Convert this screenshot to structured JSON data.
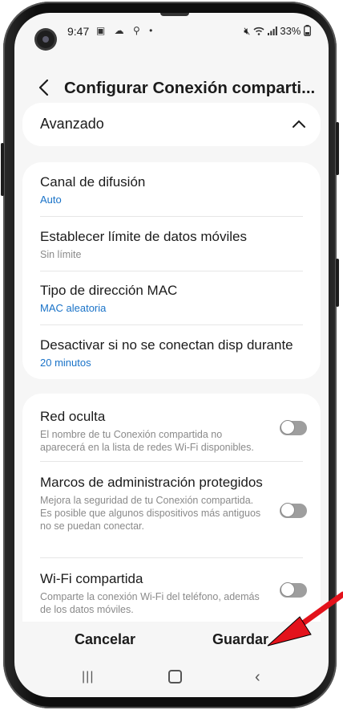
{
  "status_bar": {
    "time": "9:47",
    "left_icons": "▣ ☁ ⚲ •",
    "right_text": "33%"
  },
  "header": {
    "title": "Configurar Conexión comparti..."
  },
  "advanced": {
    "label": "Avanzado"
  },
  "settings": [
    {
      "title": "Canal de difusión",
      "value": "Auto"
    },
    {
      "title": "Establecer límite de datos móviles",
      "value": "Sin límite"
    },
    {
      "title": "Tipo de dirección MAC",
      "value": "MAC aleatoria"
    },
    {
      "title": "Desactivar si no se conectan disp durante",
      "value": "20 minutos"
    }
  ],
  "toggles": [
    {
      "title": "Red oculta",
      "description": "El nombre de tu Conexión compartida no aparecerá en la lista de redes Wi-Fi disponibles.",
      "on": false
    },
    {
      "title": "Marcos de administración protegidos",
      "description": "Mejora la seguridad de tu Conexión compartida. Es posible que algunos dispositivos más antiguos no se puedan conectar.",
      "on": false
    },
    {
      "title": "Wi-Fi compartida",
      "description": "Comparte la conexión Wi-Fi del teléfono, además de los datos móviles.",
      "on": false
    }
  ],
  "actions": {
    "cancel": "Cancelar",
    "save": "Guardar"
  },
  "navbar": {
    "recent": "|||",
    "back": "‹"
  },
  "colors": {
    "link_blue": "#1a73c8",
    "arrow_red": "#e3121b"
  }
}
